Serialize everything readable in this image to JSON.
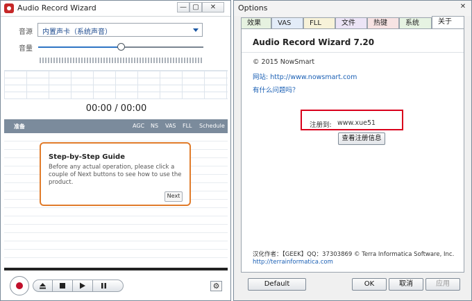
{
  "left_window": {
    "title": "Audio Record Wizard",
    "source_label": "音源",
    "source_value": "内置声卡（系统声音）",
    "volume_label": "音量",
    "volume_level": 0.5,
    "time_display": "00:00 / 00:00",
    "columns": [
      "准备",
      "AGC",
      "NS",
      "VAS",
      "FLL",
      "Schedule"
    ],
    "guide": {
      "title": "Step-by-Step Guide",
      "body": "Before any actual operation, please click a couple of Next buttons to see how to use the product.",
      "next_label": "Next"
    },
    "transport_icons": [
      "record-icon",
      "eject-icon",
      "stop-icon",
      "play-icon",
      "pause-icon",
      "gear-icon"
    ]
  },
  "right_window": {
    "title": "Options",
    "close_label": "✕",
    "tabs": [
      {
        "label": "效果",
        "color": "#e6f2e0"
      },
      {
        "label": "VAS",
        "color": "#e3ecf8"
      },
      {
        "label": "FLL",
        "color": "#f7f2d9"
      },
      {
        "label": "文件",
        "color": "#ece4f6"
      },
      {
        "label": "热键",
        "color": "#f7e3e3"
      },
      {
        "label": "系统",
        "color": "#e6f3e2"
      },
      {
        "label": "关于",
        "color": "#ffffff"
      }
    ],
    "active_tab": "关于",
    "about": {
      "product": "Audio Record Wizard 7.20",
      "copyright": "© 2015 NowSmart",
      "website_label": "网站:",
      "website_url": "http://www.nowsmart.com",
      "question_link": "有什么问题吗？",
      "registered_label": "注册到:",
      "registered_value": "www.xue51",
      "view_reg_button": "查看注册信息",
      "translator": "汉化作者：【GEEK】QQ：37303869 © Terra Informatica Software, Inc.",
      "translator_url": "http://terrainformatica.com"
    },
    "buttons": {
      "default": "Default",
      "ok": "OK",
      "cancel": "取消",
      "apply": "应用"
    }
  },
  "colors": {
    "accent_blue": "#1a5fb4",
    "highlight_red": "#d9001b",
    "guide_orange": "#e07b2a"
  }
}
